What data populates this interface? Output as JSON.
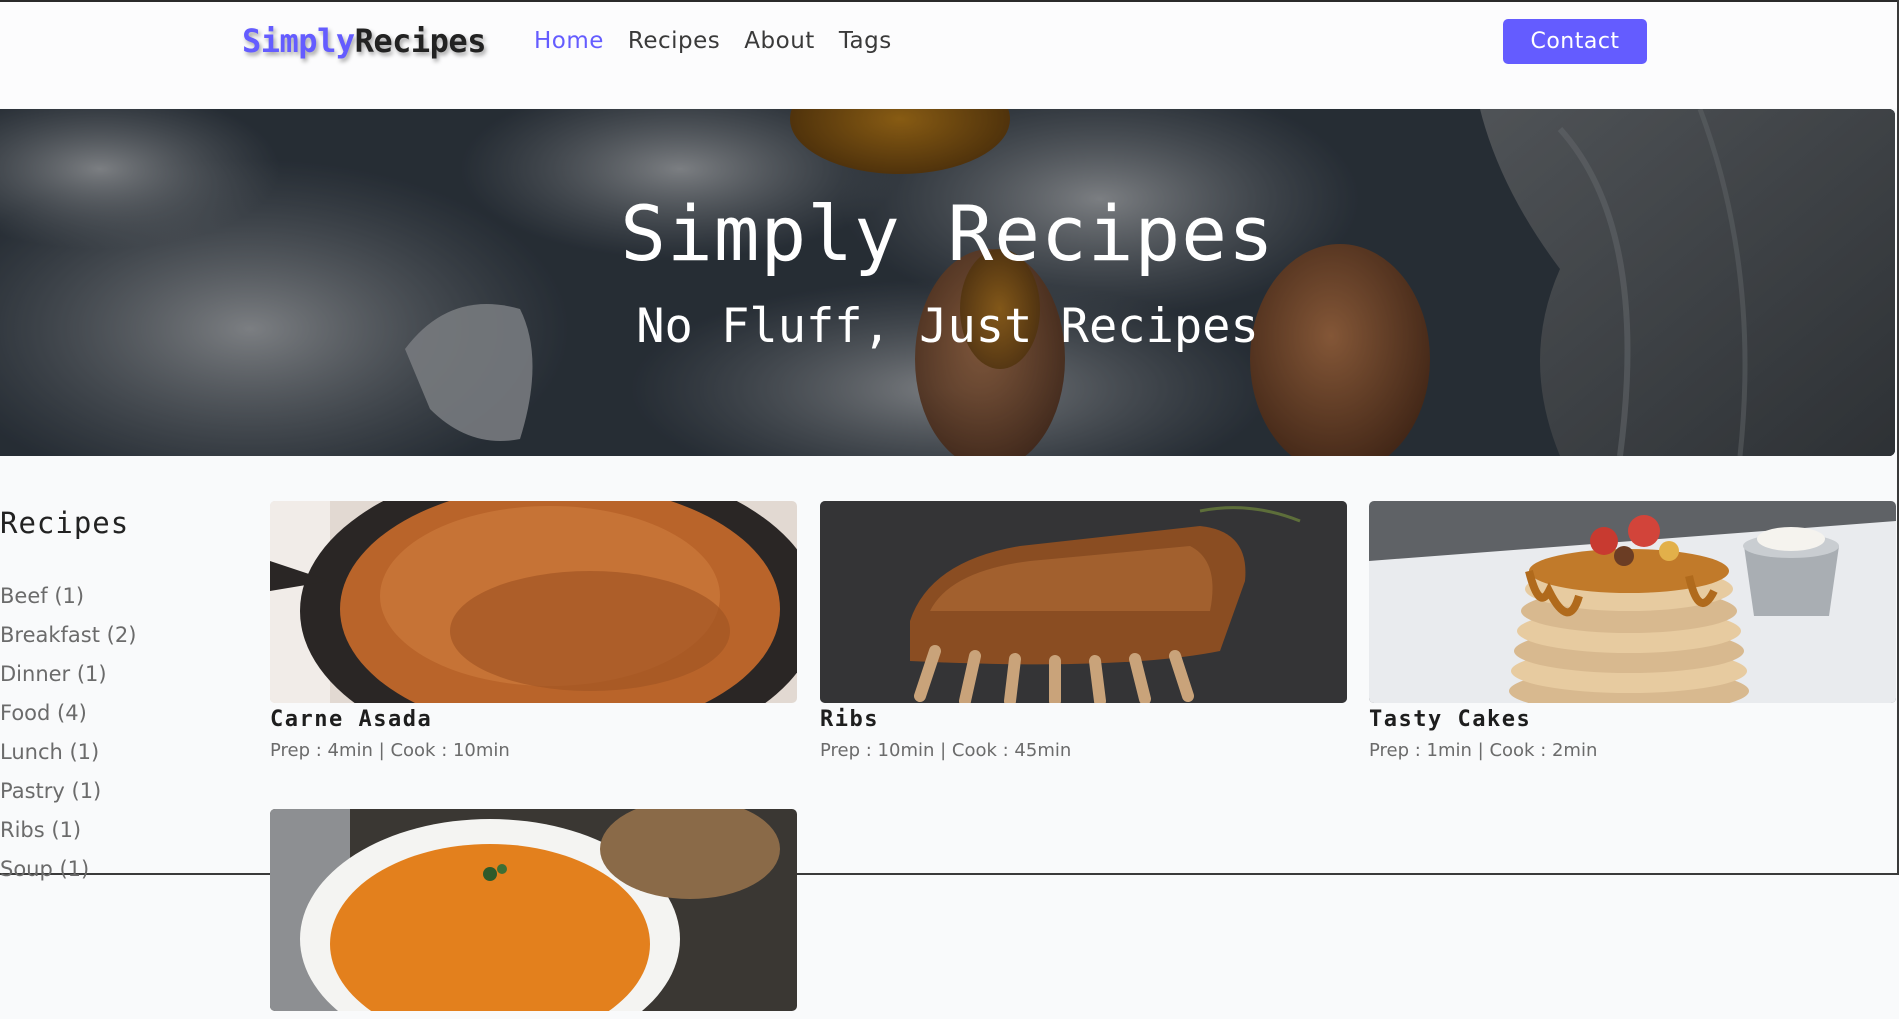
{
  "nav": {
    "logo_part1": "Simply",
    "logo_part2": "Recipes",
    "links": [
      {
        "label": "Home",
        "active": true
      },
      {
        "label": "Recipes",
        "active": false
      },
      {
        "label": "About",
        "active": false
      },
      {
        "label": "Tags",
        "active": false
      }
    ],
    "contact_label": "Contact",
    "accent_color": "#645cff"
  },
  "hero": {
    "title": "Simply Recipes",
    "subtitle": "No Fluff, Just Recipes"
  },
  "sidebar": {
    "title": "Recipes",
    "items": [
      {
        "label": "Beef (1)"
      },
      {
        "label": "Breakfast (2)"
      },
      {
        "label": "Dinner (1)"
      },
      {
        "label": "Food (4)"
      },
      {
        "label": "Lunch (1)"
      },
      {
        "label": "Pastry (1)"
      },
      {
        "label": "Ribs (1)"
      },
      {
        "label": "Soup (1)"
      }
    ]
  },
  "recipes": [
    {
      "title": "Carne Asada",
      "meta": "Prep : 4min | Cook : 10min"
    },
    {
      "title": "Ribs",
      "meta": "Prep : 10min | Cook : 45min"
    },
    {
      "title": "Tasty Cakes",
      "meta": "Prep : 1min | Cook : 2min"
    },
    {
      "title": "",
      "meta": ""
    }
  ]
}
